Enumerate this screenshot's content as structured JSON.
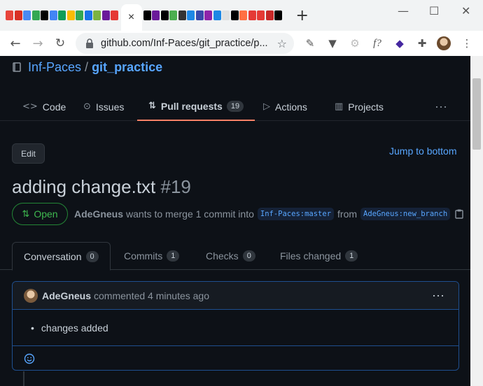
{
  "browser": {
    "favicon_colors": [
      "#e8453c",
      "#d93025",
      "#4a8af4",
      "#34a853",
      "#000000",
      "#4285f4",
      "#0f9d58",
      "#fbbc04",
      "#34a853",
      "#1a73e8",
      "#7cb342",
      "#6a1b9a",
      "#e53935"
    ],
    "favicon_colors_right": [
      "#000000",
      "#6a1b9a",
      "#000000",
      "#4caf50",
      "#333333",
      "#1e88e5",
      "#3949ab",
      "#8e24aa",
      "#1e88e5",
      "#e0e0e0",
      "#000000",
      "#ff7043",
      "#e53935",
      "#e53935",
      "#c62828",
      "#000000"
    ],
    "active_tab_close": "×",
    "new_tab": "+",
    "url": "github.com/Inf-Paces/git_practice/p...",
    "window_controls": [
      "—",
      "☐",
      "✕"
    ]
  },
  "repo": {
    "owner": "Inf-Paces",
    "separator": "/",
    "name": "git_practice"
  },
  "repo_tabs": [
    {
      "label": "Code",
      "icon": "<>"
    },
    {
      "label": "Issues",
      "icon": "⊙"
    },
    {
      "label": "Pull requests",
      "icon": "⇅",
      "count": "19"
    },
    {
      "label": "Actions",
      "icon": "▷"
    },
    {
      "label": "Projects",
      "icon": "▥"
    }
  ],
  "more": "···",
  "pr": {
    "edit": "Edit",
    "jump": "Jump to bottom",
    "title": "adding change.txt",
    "number": "#19",
    "state": "Open",
    "author": "AdeGneus",
    "meta_text": "wants to merge 1 commit into",
    "base": "Inf-Paces:master",
    "from": "from",
    "head": "AdeGneus:new_branch"
  },
  "pr_tabs": [
    {
      "label": "Conversation",
      "count": "0"
    },
    {
      "label": "Commits",
      "count": "1"
    },
    {
      "label": "Checks",
      "count": "0"
    },
    {
      "label": "Files changed",
      "count": "1"
    }
  ],
  "comment": {
    "author": "AdeGneus",
    "action": "commented 4 minutes ago",
    "body": "changes added"
  },
  "colors": {
    "accent": "#58a6ff",
    "open": "#3fb950",
    "tab_underline": "#f78166"
  }
}
